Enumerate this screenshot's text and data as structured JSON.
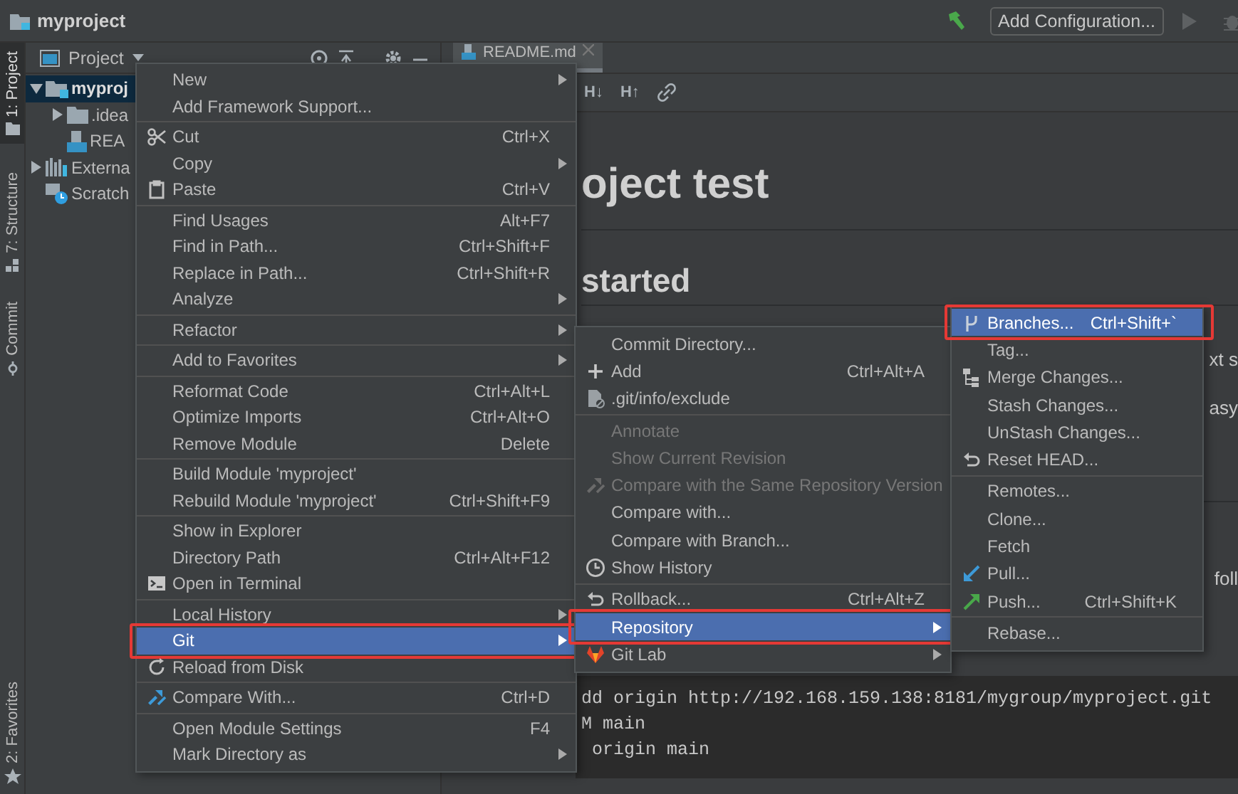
{
  "window": {
    "title": "myproject"
  },
  "toolbar": {
    "run_configuration": "Add Configuration..."
  },
  "tool_stripe": [
    {
      "label": "1: Project",
      "selected": true
    },
    {
      "label": "7: Structure",
      "selected": false
    },
    {
      "label": "Commit",
      "selected": false
    },
    {
      "label": "2: Favorites",
      "selected": false
    }
  ],
  "project_panel": {
    "title": "Project",
    "tree": [
      {
        "label": "myproj",
        "kind": "module",
        "expanded": true,
        "selected": true,
        "children": [
          {
            "label": ".idea",
            "kind": "folder",
            "expanded": false,
            "selected": false
          },
          {
            "label": "REA",
            "kind": "markdown",
            "selected": false
          }
        ]
      },
      {
        "label": "Externa",
        "kind": "libraries",
        "expanded": false,
        "selected": false
      },
      {
        "label": "Scratch",
        "kind": "scratches",
        "selected": false
      }
    ]
  },
  "editor": {
    "tab": {
      "label": "README.md",
      "selected": true
    },
    "format_buttons": [
      "H↓",
      "H↑"
    ],
    "preview": {
      "heading": "oject test",
      "subheading": "started",
      "text_1": "xt s",
      "text_2": "asy",
      "text_3": "foll",
      "code_lines": [
        "dd origin http://192.168.159.138:8181/mygroup/myproject.git",
        "M main",
        " origin main"
      ]
    }
  },
  "context_menu": {
    "items": [
      {
        "kind": "item",
        "label": "New",
        "submenu": true,
        "selected": false,
        "highlighted": false
      },
      {
        "kind": "item",
        "label": "Add Framework Support...",
        "selected": false,
        "highlighted": false
      },
      {
        "kind": "separator"
      },
      {
        "kind": "item",
        "label": "Cut",
        "shortcut": "Ctrl+X",
        "selected": false,
        "highlighted": false
      },
      {
        "kind": "item",
        "label": "Copy",
        "submenu": true,
        "selected": false,
        "highlighted": false
      },
      {
        "kind": "item",
        "label": "Paste",
        "shortcut": "Ctrl+V",
        "selected": false,
        "highlighted": false
      },
      {
        "kind": "separator"
      },
      {
        "kind": "item",
        "label": "Find Usages",
        "shortcut": "Alt+F7",
        "selected": false,
        "highlighted": false
      },
      {
        "kind": "item",
        "label": "Find in Path...",
        "shortcut": "Ctrl+Shift+F",
        "selected": false,
        "highlighted": false
      },
      {
        "kind": "item",
        "label": "Replace in Path...",
        "shortcut": "Ctrl+Shift+R",
        "selected": false,
        "highlighted": false
      },
      {
        "kind": "item",
        "label": "Analyze",
        "submenu": true,
        "selected": false,
        "highlighted": false
      },
      {
        "kind": "separator"
      },
      {
        "kind": "item",
        "label": "Refactor",
        "submenu": true,
        "selected": false,
        "highlighted": false
      },
      {
        "kind": "separator"
      },
      {
        "kind": "item",
        "label": "Add to Favorites",
        "submenu": true,
        "selected": false,
        "highlighted": false
      },
      {
        "kind": "separator"
      },
      {
        "kind": "item",
        "label": "Reformat Code",
        "shortcut": "Ctrl+Alt+L",
        "selected": false,
        "highlighted": false
      },
      {
        "kind": "item",
        "label": "Optimize Imports",
        "shortcut": "Ctrl+Alt+O",
        "selected": false,
        "highlighted": false
      },
      {
        "kind": "item",
        "label": "Remove Module",
        "shortcut": "Delete",
        "selected": false,
        "highlighted": false
      },
      {
        "kind": "separator"
      },
      {
        "kind": "item",
        "label": "Build Module 'myproject'",
        "selected": false,
        "highlighted": false
      },
      {
        "kind": "item",
        "label": "Rebuild Module 'myproject'",
        "shortcut": "Ctrl+Shift+F9",
        "selected": false,
        "highlighted": false
      },
      {
        "kind": "separator"
      },
      {
        "kind": "item",
        "label": "Show in Explorer",
        "selected": false,
        "highlighted": false
      },
      {
        "kind": "item",
        "label": "Directory Path",
        "shortcut": "Ctrl+Alt+F12",
        "selected": false,
        "highlighted": false
      },
      {
        "kind": "item",
        "label": "Open in Terminal",
        "selected": false,
        "highlighted": false
      },
      {
        "kind": "separator"
      },
      {
        "kind": "item",
        "label": "Local History",
        "submenu": true,
        "selected": false,
        "highlighted": false
      },
      {
        "kind": "item",
        "label": "Git",
        "submenu": true,
        "selected": true,
        "highlighted": true
      },
      {
        "kind": "item",
        "label": "Reload from Disk",
        "selected": false,
        "highlighted": false
      },
      {
        "kind": "separator"
      },
      {
        "kind": "item",
        "label": "Compare With...",
        "shortcut": "Ctrl+D",
        "selected": false,
        "highlighted": false
      },
      {
        "kind": "separator"
      },
      {
        "kind": "item",
        "label": "Open Module Settings",
        "shortcut": "F4",
        "selected": false,
        "highlighted": false
      },
      {
        "kind": "item",
        "label": "Mark Directory as",
        "submenu": true,
        "selected": false,
        "highlighted": false
      }
    ]
  },
  "git_submenu": {
    "items": [
      {
        "kind": "item",
        "label": "Commit Directory...",
        "selected": false,
        "disabled": false,
        "highlighted": false
      },
      {
        "kind": "item",
        "label": "Add",
        "shortcut": "Ctrl+Alt+A",
        "selected": false,
        "disabled": false,
        "highlighted": false
      },
      {
        "kind": "item",
        "label": ".git/info/exclude",
        "selected": false,
        "disabled": false,
        "highlighted": false
      },
      {
        "kind": "separator"
      },
      {
        "kind": "item",
        "label": "Annotate",
        "selected": false,
        "disabled": true,
        "highlighted": false
      },
      {
        "kind": "item",
        "label": "Show Current Revision",
        "selected": false,
        "disabled": true,
        "highlighted": false
      },
      {
        "kind": "item",
        "label": "Compare with the Same Repository Version",
        "selected": false,
        "disabled": true,
        "highlighted": false
      },
      {
        "kind": "item",
        "label": "Compare with...",
        "selected": false,
        "disabled": false,
        "highlighted": false
      },
      {
        "kind": "item",
        "label": "Compare with Branch...",
        "selected": false,
        "disabled": false,
        "highlighted": false
      },
      {
        "kind": "item",
        "label": "Show History",
        "selected": false,
        "disabled": false,
        "highlighted": false
      },
      {
        "kind": "separator"
      },
      {
        "kind": "item",
        "label": "Rollback...",
        "shortcut": "Ctrl+Alt+Z",
        "selected": false,
        "disabled": false,
        "highlighted": false
      },
      {
        "kind": "item",
        "label": "Repository",
        "submenu": true,
        "selected": true,
        "disabled": false,
        "highlighted": true
      },
      {
        "kind": "item",
        "label": "Git Lab",
        "submenu": true,
        "selected": false,
        "disabled": false,
        "highlighted": false
      }
    ]
  },
  "repository_submenu": {
    "items": [
      {
        "kind": "item",
        "label": "Branches...",
        "shortcut": "Ctrl+Shift+`",
        "selected": true,
        "highlighted": true
      },
      {
        "kind": "item",
        "label": "Tag...",
        "selected": false,
        "highlighted": false
      },
      {
        "kind": "item",
        "label": "Merge Changes...",
        "selected": false,
        "highlighted": false
      },
      {
        "kind": "item",
        "label": "Stash Changes...",
        "selected": false,
        "highlighted": false
      },
      {
        "kind": "item",
        "label": "UnStash Changes...",
        "selected": false,
        "highlighted": false
      },
      {
        "kind": "item",
        "label": "Reset HEAD...",
        "selected": false,
        "highlighted": false
      },
      {
        "kind": "separator"
      },
      {
        "kind": "item",
        "label": "Remotes...",
        "selected": false,
        "highlighted": false
      },
      {
        "kind": "item",
        "label": "Clone...",
        "selected": false,
        "highlighted": false
      },
      {
        "kind": "item",
        "label": "Fetch",
        "selected": false,
        "highlighted": false
      },
      {
        "kind": "item",
        "label": "Pull...",
        "selected": false,
        "highlighted": false
      },
      {
        "kind": "item",
        "label": "Push...",
        "shortcut": "Ctrl+Shift+K",
        "selected": false,
        "highlighted": false
      },
      {
        "kind": "separator"
      },
      {
        "kind": "item",
        "label": "Rebase...",
        "selected": false,
        "highlighted": false
      }
    ]
  }
}
